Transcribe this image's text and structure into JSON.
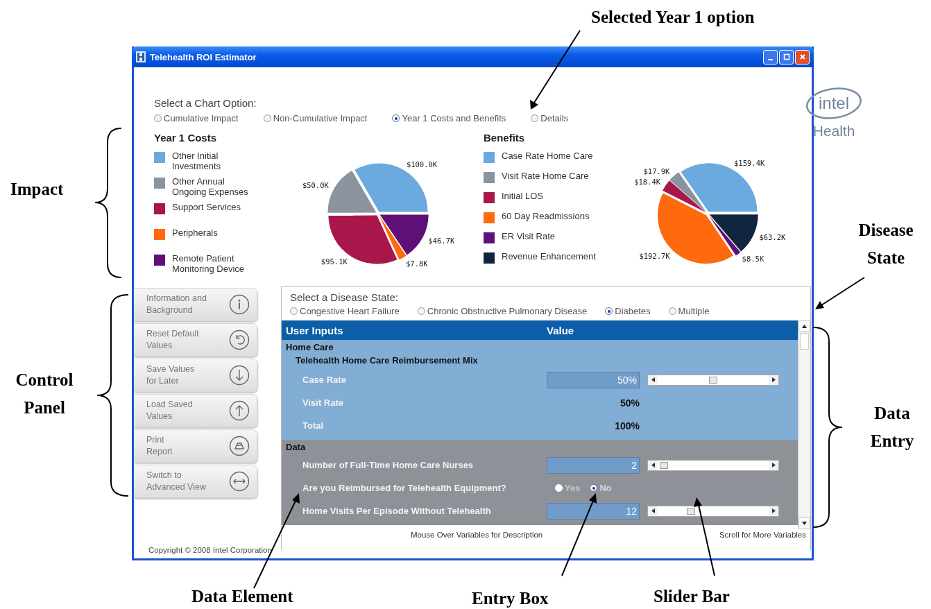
{
  "callouts": {
    "selected_year_option": "Selected Year 1 option",
    "impact": "Impact",
    "control_panel": "Control Panel",
    "disease_state": "Disease State",
    "data_entry": "Data Entry",
    "data_element": "Data Element",
    "entry_box": "Entry Box",
    "slider_bar": "Slider Bar"
  },
  "window": {
    "title": "Telehealth ROI Estimator",
    "logo": {
      "brand": "intel",
      "sub": "Health"
    }
  },
  "chart_options": {
    "label": "Select a Chart Option:",
    "options": [
      {
        "label": "Cumulative Impact",
        "selected": false
      },
      {
        "label": "Non-Cumulative Impact",
        "selected": false
      },
      {
        "label": "Year 1 Costs and Benefits",
        "selected": true
      },
      {
        "label": "Details",
        "selected": false
      }
    ]
  },
  "costs": {
    "title": "Year 1 Costs",
    "chart_data": {
      "type": "pie",
      "legend": "left",
      "categories": [
        "Other Initial Investments",
        "Other Annual Ongoing Expenses",
        "Support Services",
        "Peripherals",
        "Remote Patient Monitoring Device"
      ],
      "values": [
        100.0,
        50.0,
        95.1,
        7.8,
        46.7
      ],
      "colors": [
        "#6aaade",
        "#8b949e",
        "#a8164c",
        "#ff6a0e",
        "#5f0f78"
      ],
      "value_labels": [
        "$100.0K",
        "$50.0K",
        "$95.1K",
        "$7.8K",
        "$46.7K"
      ]
    }
  },
  "benefits": {
    "title": "Benefits",
    "chart_data": {
      "type": "pie",
      "legend": "left",
      "categories": [
        "Case Rate Home Care",
        "Visit Rate Home Care",
        "Initial LOS",
        "60 Day Readmissions",
        "ER Visit Rate",
        "Revenue Enhancement"
      ],
      "values": [
        159.4,
        17.9,
        18.4,
        192.7,
        8.5,
        63.2
      ],
      "colors": [
        "#6aaade",
        "#8b949e",
        "#a8164c",
        "#ff6a0e",
        "#5f0f78",
        "#11253e"
      ],
      "value_labels": [
        "$159.4K",
        "$17.9K",
        "$18.4K",
        "$192.7K",
        "$8.5K",
        "$63.2K"
      ]
    }
  },
  "control_panel": [
    {
      "label": "Information and\nBackground"
    },
    {
      "label": "Reset Default\nValues"
    },
    {
      "label": "Save Values\nfor Later"
    },
    {
      "label": "Load Saved\nValues"
    },
    {
      "label": "Print\nReport"
    },
    {
      "label": "Switch to\nAdvanced View"
    }
  ],
  "disease": {
    "label": "Select a Disease State:",
    "options": [
      {
        "label": "Congestive Heart Failure",
        "selected": false
      },
      {
        "label": "Chronic Obstructive Pulmonary Disease",
        "selected": false
      },
      {
        "label": "Diabetes",
        "selected": true
      },
      {
        "label": "Multiple",
        "selected": false
      }
    ],
    "table": {
      "columns": [
        "User Inputs",
        "Value"
      ],
      "sections": [
        {
          "title": "Home Care",
          "color": "#82add4",
          "rows": [
            {
              "kind": "subheading",
              "label": "Telehealth Home Care Reimbursement Mix"
            },
            {
              "kind": "slider",
              "label": "Case Rate",
              "value": "50%",
              "level": 0.5
            },
            {
              "kind": "value",
              "label": "Visit Rate",
              "value": "50%"
            },
            {
              "kind": "value",
              "label": "Total",
              "value": "100%"
            }
          ]
        },
        {
          "title": "Data",
          "color": "#8f9199",
          "rows": [
            {
              "kind": "slider",
              "label": "Number of Full-Time Home Care Nurses",
              "value": "2"
            },
            {
              "kind": "choice",
              "label": "Are you Reimbursed for Telehealth Equipment?",
              "options": [
                {
                  "label": "Yes",
                  "selected": false
                },
                {
                  "label": "No",
                  "selected": true
                }
              ]
            },
            {
              "kind": "slider",
              "label": "Home Visits Per Episode Without Telehealth",
              "value": "12",
              "level": 0.3
            }
          ]
        }
      ]
    }
  },
  "footer": {
    "hint": "Mouse Over Variables for Description",
    "scroll_hint": "Scroll for More Variables",
    "copyright": "Copyright © 2008 Intel Corporation"
  }
}
